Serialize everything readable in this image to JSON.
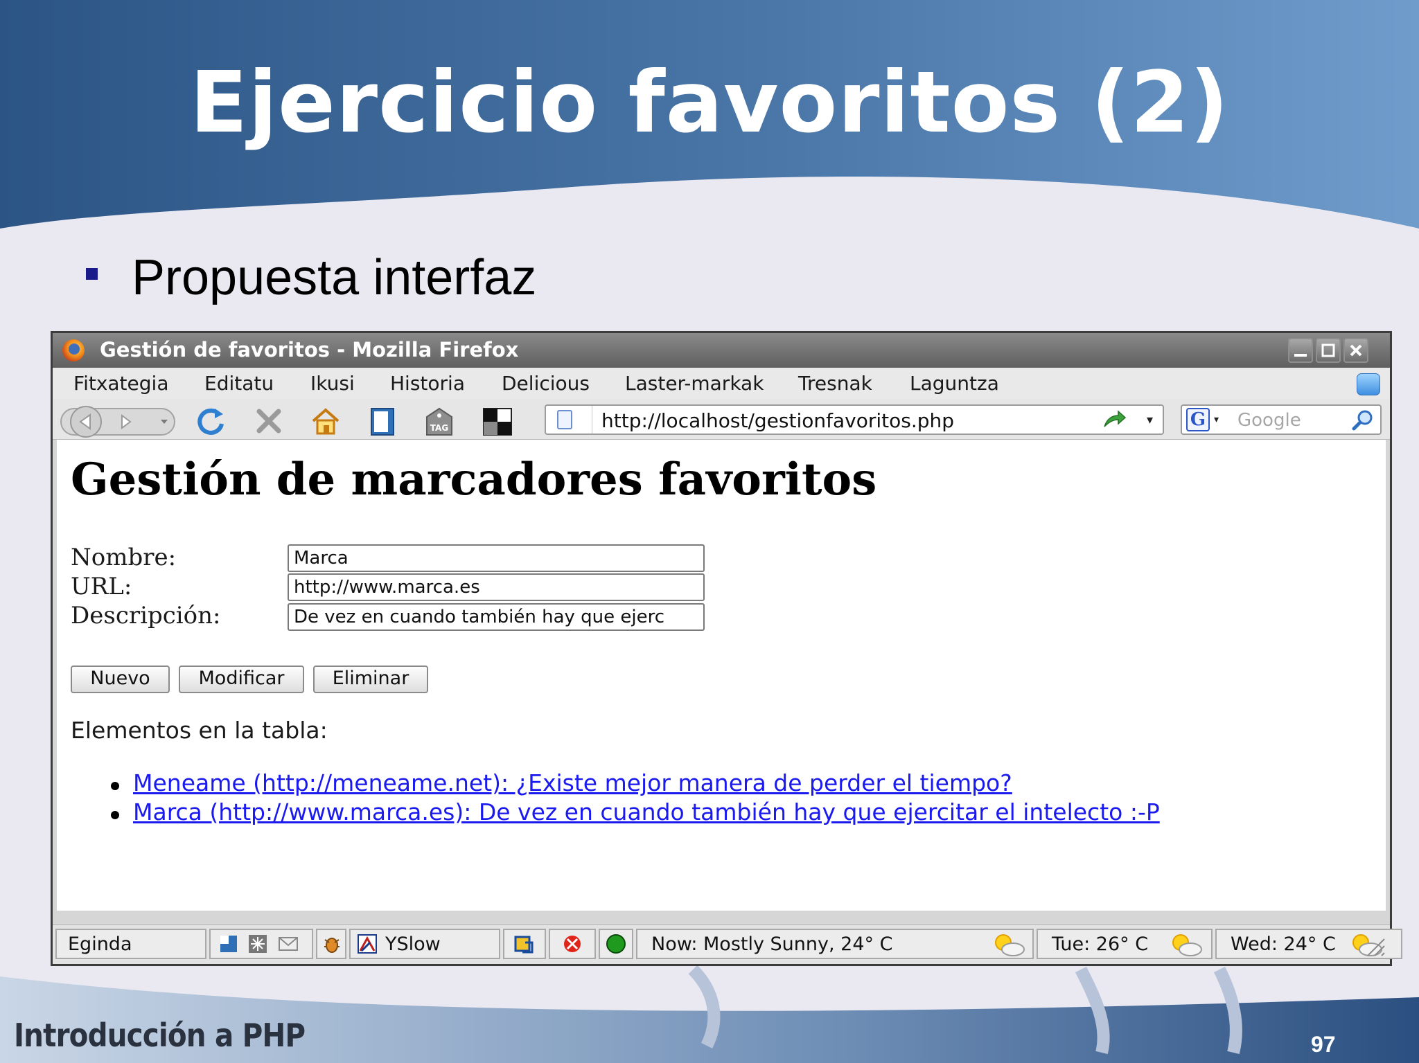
{
  "slide": {
    "title": "Ejercicio favoritos (2)",
    "bullet": "Propuesta interfaz",
    "footer": "Introducción a PHP",
    "page_number": "97"
  },
  "window": {
    "title": "Gestión de favoritos - Mozilla Firefox",
    "controls": [
      "minimize-icon",
      "maximize-icon",
      "close-icon"
    ]
  },
  "menu": [
    "Fitxategia",
    "Editatu",
    "Ikusi",
    "Historia",
    "Delicious",
    "Laster-markak",
    "Tresnak",
    "Laguntza"
  ],
  "toolbar": {
    "url": "http://localhost/gestionfavoritos.php",
    "search_placeholder": "Google",
    "icons": [
      "back-icon",
      "forward-icon",
      "reload-icon",
      "stop-icon",
      "home-icon",
      "bookmark-icon",
      "tag-icon",
      "delicious-icon"
    ],
    "tag_label": "TAG"
  },
  "page": {
    "heading": "Gestión de marcadores favoritos",
    "form": {
      "name_label": "Nombre:",
      "name_value": "Marca",
      "url_label": "URL:",
      "url_value": "http://www.marca.es",
      "desc_label": "Descripción:",
      "desc_value": "De vez en cuando también hay que ejerc"
    },
    "buttons": {
      "new": "Nuevo",
      "modify": "Modificar",
      "delete": "Eliminar"
    },
    "list_label": "Elementos en la tabla:",
    "items": [
      "Meneame (http://meneame.net): ¿Existe mejor manera de perder el tiempo?",
      "Marca (http://www.marca.es): De vez en cuando también hay que ejercitar el intelecto :-P"
    ]
  },
  "status": {
    "text": "Egindа",
    "yslow": "YSlow",
    "weather_now": "Now: Mostly Sunny, 24° C",
    "weather_tue": "Tue: 26° C",
    "weather_wed": "Wed: 24° C"
  },
  "colors": {
    "header_blue": "#3d6491",
    "link": "#1a1aee",
    "bullet": "#1a1a8a"
  }
}
